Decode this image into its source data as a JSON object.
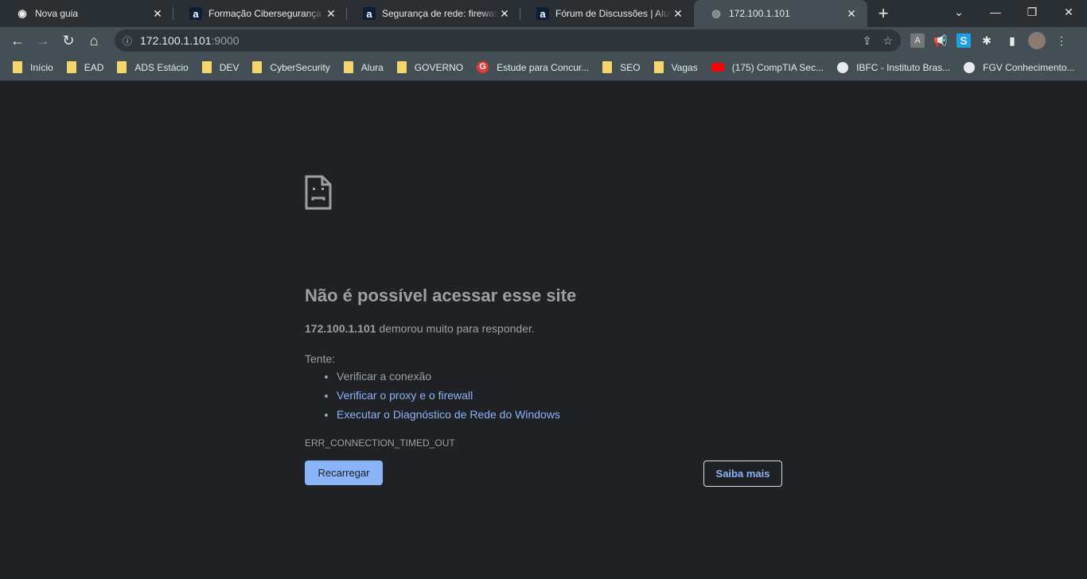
{
  "tabs": [
    {
      "title": "Nova guia",
      "icon": "chrome-icon"
    },
    {
      "title": "Formação Cibersegurança | Alura",
      "icon": "alura-icon"
    },
    {
      "title": "Segurança de rede: firewall, VPN",
      "icon": "alura-icon"
    },
    {
      "title": "Fórum de Discussões | Alura",
      "icon": "alura-icon"
    },
    {
      "title": "172.100.1.101",
      "icon": "globe-icon",
      "active": true
    }
  ],
  "address": {
    "host": "172.100.1.101",
    "port": ":9000"
  },
  "bookmarks": [
    {
      "label": "Início",
      "icon": "folder"
    },
    {
      "label": "EAD",
      "icon": "folder"
    },
    {
      "label": "ADS Estácio",
      "icon": "folder"
    },
    {
      "label": "DEV",
      "icon": "folder"
    },
    {
      "label": "CyberSecurity",
      "icon": "folder"
    },
    {
      "label": "Alura",
      "icon": "folder"
    },
    {
      "label": "GOVERNO",
      "icon": "folder"
    },
    {
      "label": "Estude para Concur...",
      "icon": "g-icon"
    },
    {
      "label": "SEO",
      "icon": "folder"
    },
    {
      "label": "Vagas",
      "icon": "folder"
    },
    {
      "label": "(175) CompTIA Sec...",
      "icon": "youtube-icon"
    },
    {
      "label": "IBFC - Instituto Bras...",
      "icon": "globe-icon"
    },
    {
      "label": "FGV Conhecimento...",
      "icon": "globe-icon"
    }
  ],
  "error": {
    "title": "Não é possível acessar esse site",
    "host": "172.100.1.101",
    "message": " demorou muito para responder.",
    "try_label": "Tente:",
    "suggestions": [
      "Verificar a conexão",
      "Verificar o proxy e o firewall",
      "Executar o Diagnóstico de Rede do Windows"
    ],
    "code": "ERR_CONNECTION_TIMED_OUT",
    "reload_label": "Recarregar",
    "more_label": "Saiba mais"
  },
  "colors": {
    "page_bg": "#202124",
    "link": "#8ab4f8",
    "toolbar": "#434e55"
  }
}
